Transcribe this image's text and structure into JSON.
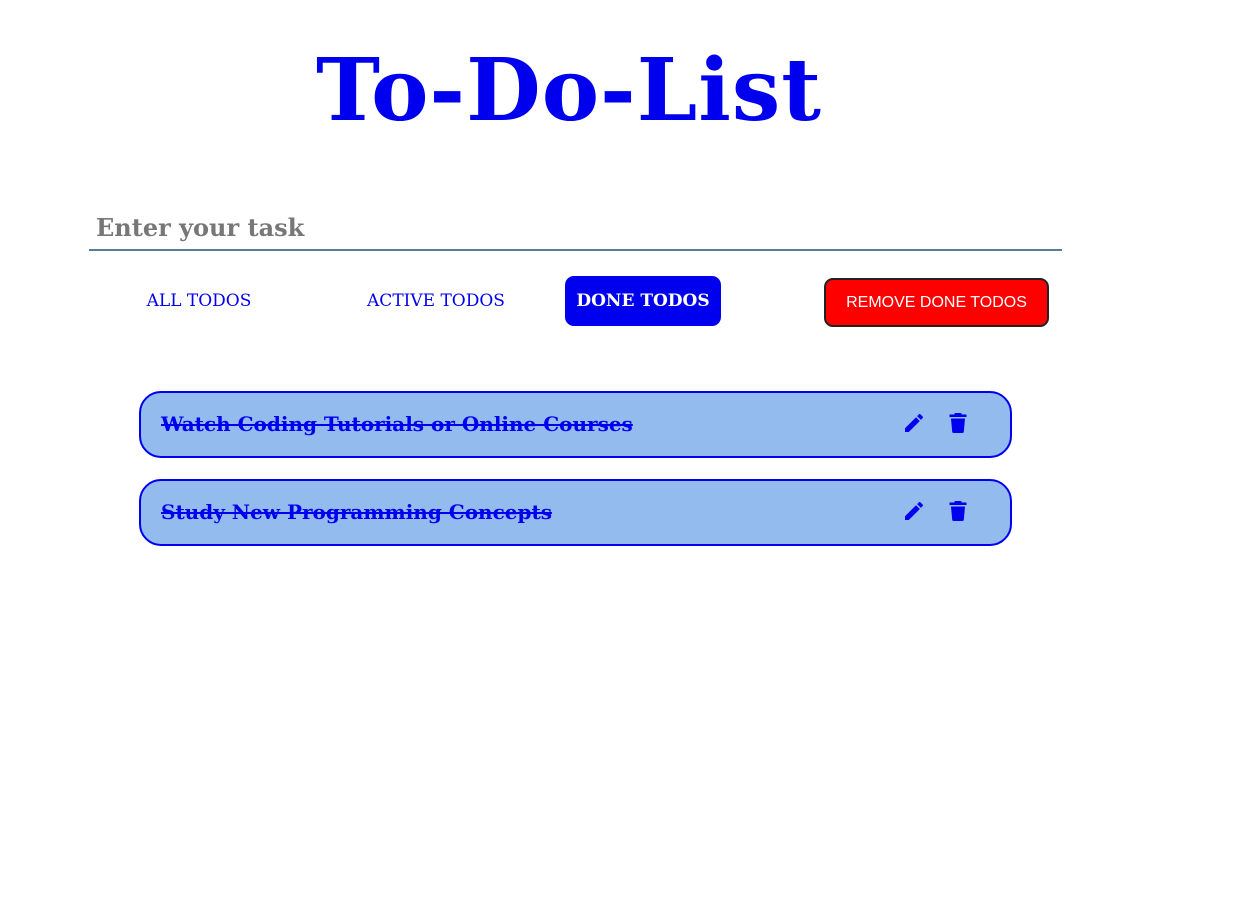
{
  "header": {
    "title": "To-Do-List"
  },
  "task_input": {
    "placeholder": "Enter your task",
    "value": ""
  },
  "filters": [
    {
      "label": "ALL TODOS",
      "active": false
    },
    {
      "label": "ACTIVE TODOS",
      "active": false
    },
    {
      "label": "DONE TODOS",
      "active": true
    }
  ],
  "remove_done_label": "REMOVE DONE TODOS",
  "todos": [
    {
      "text": "Watch Coding Tutorials or Online Courses",
      "done": true,
      "edit_icon": "pencil-icon",
      "delete_icon": "trash-icon"
    },
    {
      "text": "Study New Programming Concepts",
      "done": true,
      "edit_icon": "pencil-icon",
      "delete_icon": "trash-icon"
    }
  ],
  "colors": {
    "accent": "#0000ee",
    "item_background": "#93bbee",
    "danger": "#ff0000",
    "input_underline": "#5b7c99"
  }
}
